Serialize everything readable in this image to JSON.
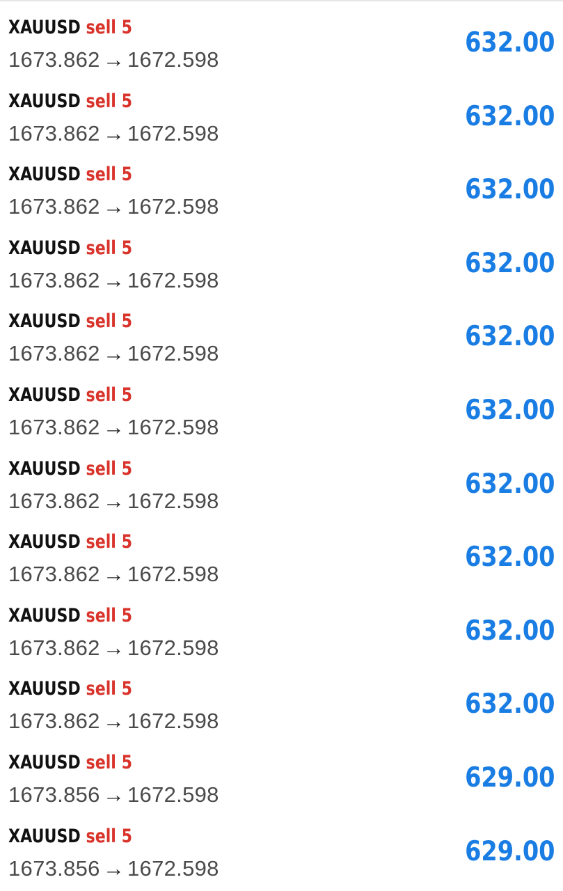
{
  "trades": [
    {
      "symbol": "XAUUSD",
      "side": "sell 5",
      "open_price": "1673.862",
      "arrow": "→",
      "close_price": "1672.598",
      "profit": "632.00"
    },
    {
      "symbol": "XAUUSD",
      "side": "sell 5",
      "open_price": "1673.862",
      "arrow": "→",
      "close_price": "1672.598",
      "profit": "632.00"
    },
    {
      "symbol": "XAUUSD",
      "side": "sell 5",
      "open_price": "1673.862",
      "arrow": "→",
      "close_price": "1672.598",
      "profit": "632.00"
    },
    {
      "symbol": "XAUUSD",
      "side": "sell 5",
      "open_price": "1673.862",
      "arrow": "→",
      "close_price": "1672.598",
      "profit": "632.00"
    },
    {
      "symbol": "XAUUSD",
      "side": "sell 5",
      "open_price": "1673.862",
      "arrow": "→",
      "close_price": "1672.598",
      "profit": "632.00"
    },
    {
      "symbol": "XAUUSD",
      "side": "sell 5",
      "open_price": "1673.862",
      "arrow": "→",
      "close_price": "1672.598",
      "profit": "632.00"
    },
    {
      "symbol": "XAUUSD",
      "side": "sell 5",
      "open_price": "1673.862",
      "arrow": "→",
      "close_price": "1672.598",
      "profit": "632.00"
    },
    {
      "symbol": "XAUUSD",
      "side": "sell 5",
      "open_price": "1673.862",
      "arrow": "→",
      "close_price": "1672.598",
      "profit": "632.00"
    },
    {
      "symbol": "XAUUSD",
      "side": "sell 5",
      "open_price": "1673.862",
      "arrow": "→",
      "close_price": "1672.598",
      "profit": "632.00"
    },
    {
      "symbol": "XAUUSD",
      "side": "sell 5",
      "open_price": "1673.862",
      "arrow": "→",
      "close_price": "1672.598",
      "profit": "632.00"
    },
    {
      "symbol": "XAUUSD",
      "side": "sell 5",
      "open_price": "1673.856",
      "arrow": "→",
      "close_price": "1672.598",
      "profit": "629.00"
    },
    {
      "symbol": "XAUUSD",
      "side": "sell 5",
      "open_price": "1673.856",
      "arrow": "→",
      "close_price": "1672.598",
      "profit": "629.00"
    }
  ],
  "colors": {
    "symbol": "#111111",
    "side_sell": "#d9342b",
    "prices": "#4a4a4a",
    "profit_positive": "#1a7de3",
    "background": "#ffffff"
  }
}
